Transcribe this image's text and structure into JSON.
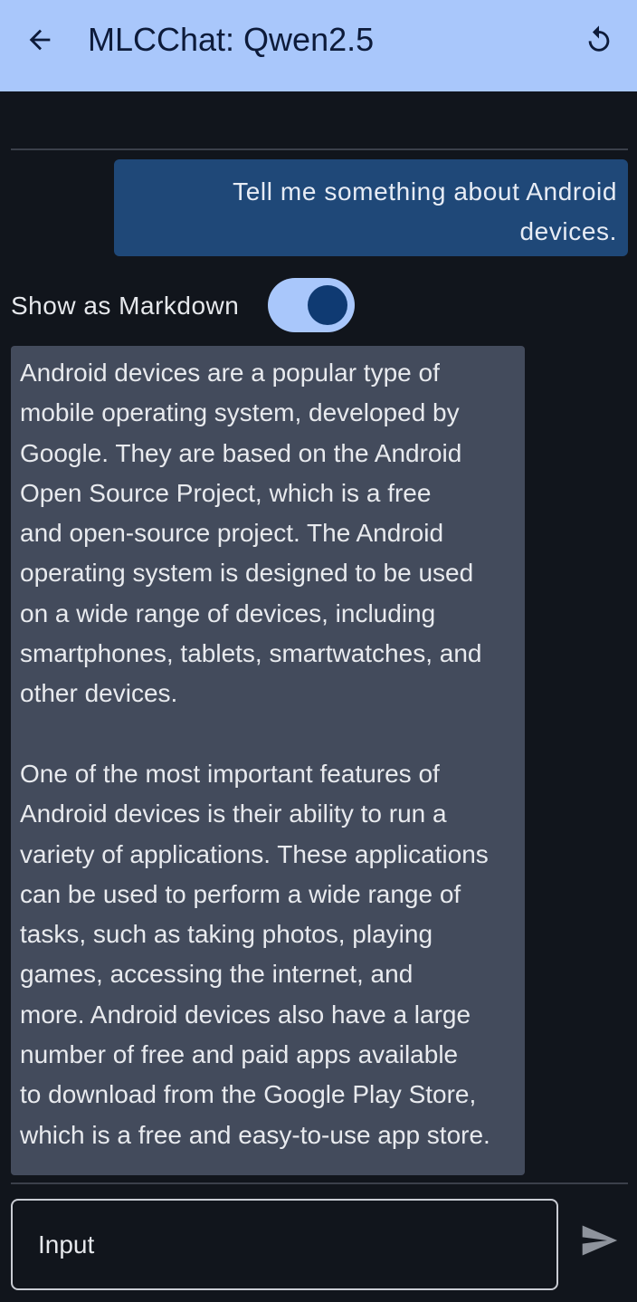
{
  "app_bar": {
    "title": "MLCChat: Qwen2.5",
    "back_icon": "arrow-back-icon",
    "reset_icon": "restart-icon",
    "background_color": "#a9c7fb"
  },
  "conversation": {
    "user_message": "Tell me something about Android devices.",
    "markdown_toggle": {
      "label": "Show as Markdown",
      "enabled": true
    },
    "assistant_message": {
      "paragraphs": [
        "Android devices are a popular type of\nmobile operating system, developed by\nGoogle. They are based on the Android\nOpen Source Project, which is a free\nand open-source project. The Android\noperating system is designed to be used\non a wide range of devices, including\nsmartphones, tablets, smartwatches, and\nother devices.",
        "One of the most important features of\nAndroid devices is their ability to run a\nvariety of applications. These applications\ncan be used to perform a wide range of\ntasks, such as taking photos, playing\ngames, accessing the internet, and\nmore. Android devices also have a large\nnumber of free and paid apps available\nto download from the Google Play Store,\nwhich is a free and easy-to-use app store."
      ]
    }
  },
  "composer": {
    "placeholder": "Input",
    "value": "",
    "send_icon": "send-icon"
  },
  "colors": {
    "background": "#11151c",
    "user_bubble": "#1f4878",
    "assistant_bubble": "#434b5c",
    "accent": "#a9c7fb"
  }
}
